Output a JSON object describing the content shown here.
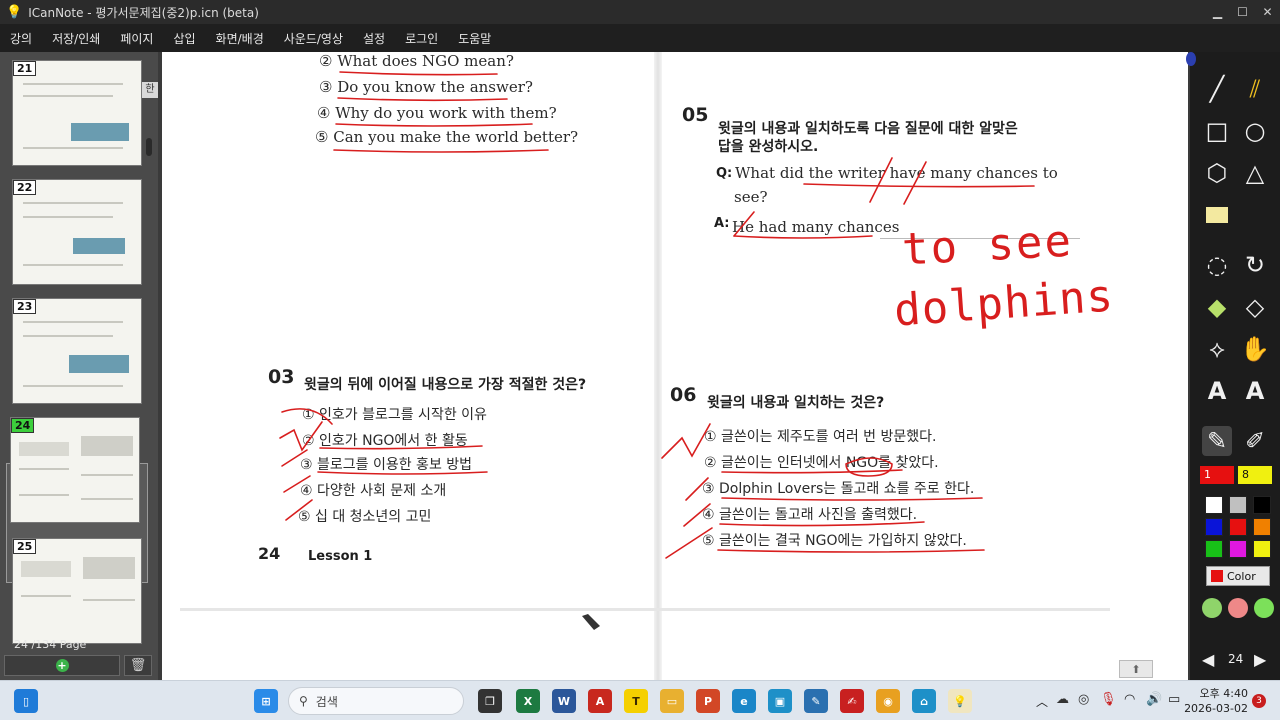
{
  "window": {
    "title": "ICanNote - 평가서문제집(중2)p.icn (beta)",
    "controls": {
      "minimize": "▁",
      "maximize": "☐",
      "close": "✕"
    }
  },
  "menu": [
    "강의",
    "저장/인쇄",
    "페이지",
    "삽입",
    "화면/배경",
    "사운드/영상",
    "설정",
    "로그인",
    "도움말"
  ],
  "sidebar": {
    "thumbnails": [
      "21",
      "22",
      "23",
      "24",
      "25"
    ],
    "active": "24",
    "page_current": "24",
    "page_total": "/134 Page",
    "ime_badge": "한"
  },
  "page": {
    "q02_options": [
      "② What does NGO mean?",
      "③ Do you know the answer?",
      "④ Why do you work with them?",
      "⑤ Can you make the world better?"
    ],
    "q03": {
      "number": "03",
      "question": "윗글의 뒤에 이어질 내용으로 가장 적절한 것은?",
      "options": [
        "① 인호가 블로그를 시작한 이유",
        "② 인호가 NGO에서 한 활동",
        "③ 블로그를 이용한 홍보 방법",
        "④ 다양한 사회 문제 소개",
        "⑤ 십 대 청소년의 고민"
      ]
    },
    "q05": {
      "number": "05",
      "question_line1": "윗글의 내용과 일치하도록 다음 질문에 대한 알맞은",
      "question_line2": "답을 완성하시오.",
      "q_label": "Q:",
      "q_text_line1": "What did the writer have many chances to",
      "q_text_line2": "see?",
      "a_label": "A:",
      "a_text": "He had many chances",
      "handwriting_line1": "to see",
      "handwriting_line2": "dolphins"
    },
    "q06": {
      "number": "06",
      "question": "윗글의 내용과 일치하는 것은?",
      "options": [
        "① 글쓴이는 제주도를 여러 번 방문했다.",
        "② 글쓴이는 인터넷에서 NGO를 찾았다.",
        "③ Dolphin Lovers는 돌고래 쇼를 주로 한다.",
        "④ 글쓴이는 돌고래 사진을 출력했다.",
        "⑤ 글쓴이는 결국 NGO에는 가입하지 않았다."
      ]
    },
    "footer_page": "24",
    "footer_lesson": "Lesson 1",
    "ink_color": "#d81e1e"
  },
  "toolbar": {
    "pen_size": "1",
    "highlighter_size": "8",
    "color_label": "Color",
    "page_number": "24",
    "prev": "◀",
    "next": "▶",
    "scroll_up": "⬆",
    "palette": [
      "#ffffff",
      "#c0c0c0",
      "#000000",
      "#0a14d8",
      "#e61010",
      "#f08000",
      "#18c018",
      "#e018e0",
      "#f0f010"
    ]
  },
  "taskbar": {
    "search_placeholder": "검색",
    "clock_time": "오후 4:40",
    "clock_date": "2026-03-02",
    "notif_count": "3"
  }
}
